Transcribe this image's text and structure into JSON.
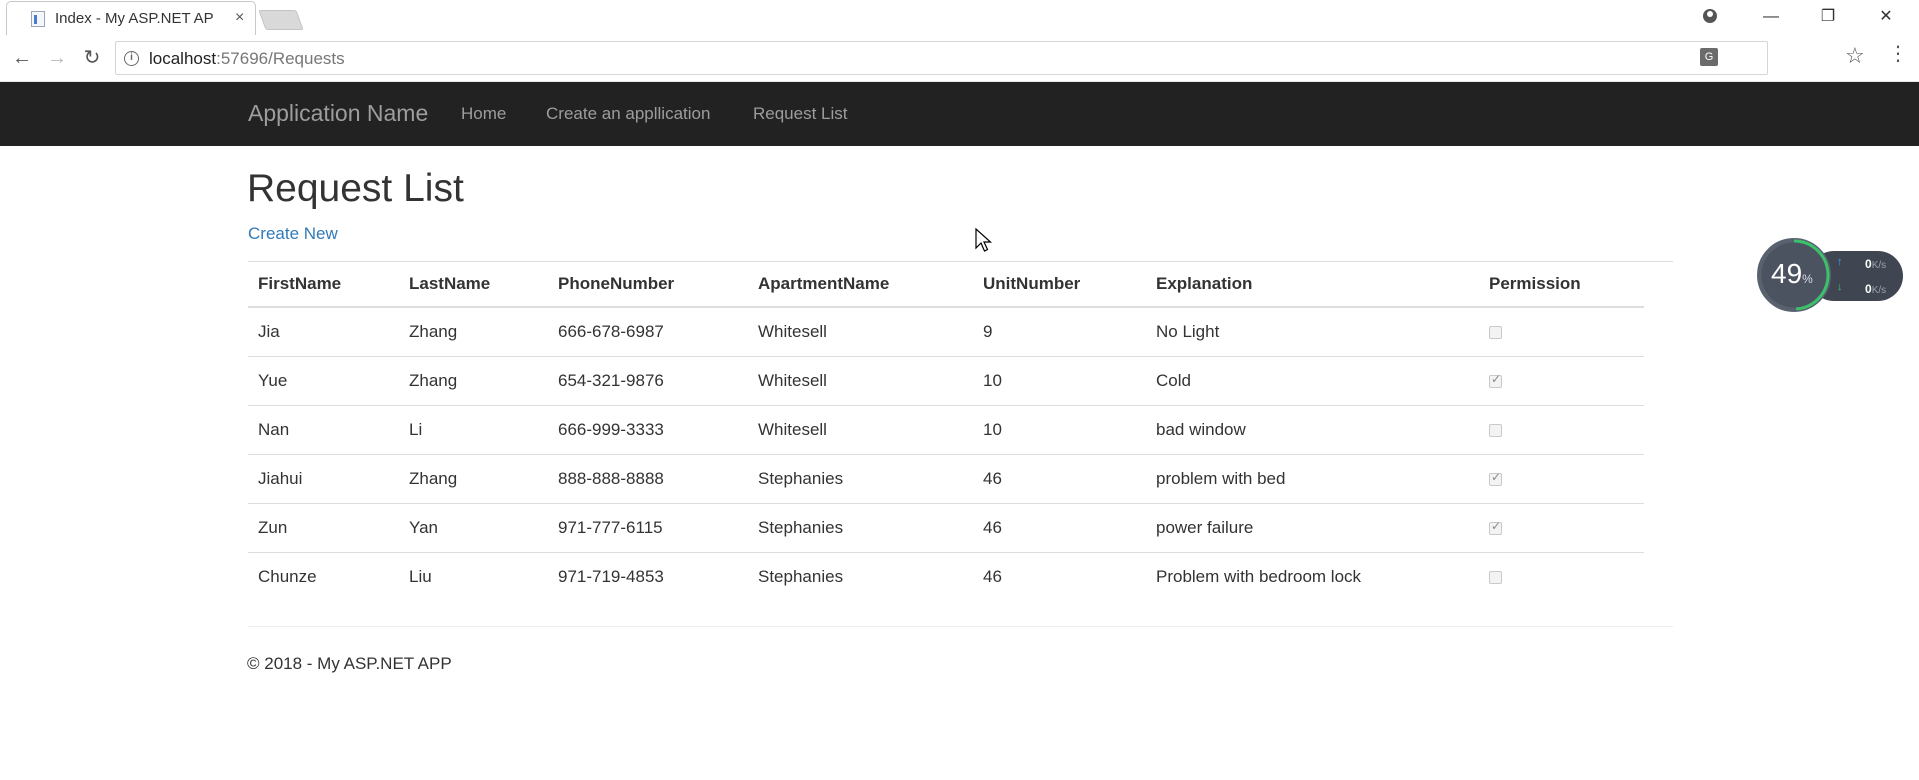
{
  "browser": {
    "tab_title": "Index - My ASP.NET AP",
    "tab_close": "×",
    "url_host": "localhost",
    "url_path": ":57696/Requests",
    "info_glyph": "i",
    "translate_glyph": "G",
    "win_min": "—",
    "win_max": "❐",
    "win_close": "✕",
    "back": "←",
    "forward": "→",
    "reload": "↻",
    "star": "☆",
    "menu": "⋮"
  },
  "navbar": {
    "brand": "Application Name",
    "links": [
      "Home",
      "Create an appllication",
      "Request List"
    ]
  },
  "page": {
    "title": "Request List",
    "create_link": "Create New"
  },
  "table": {
    "headers": [
      "FirstName",
      "LastName",
      "PhoneNumber",
      "ApartmentName",
      "UnitNumber",
      "Explanation",
      "Permission"
    ],
    "rows": [
      {
        "first": "Jia",
        "last": "Zhang",
        "phone": "666-678-6987",
        "apartment": "Whitesell",
        "unit": "9",
        "explanation": "No Light",
        "permission": false
      },
      {
        "first": "Yue",
        "last": "Zhang",
        "phone": "654-321-9876",
        "apartment": "Whitesell",
        "unit": "10",
        "explanation": "Cold",
        "permission": true
      },
      {
        "first": "Nan",
        "last": "Li",
        "phone": "666-999-3333",
        "apartment": "Whitesell",
        "unit": "10",
        "explanation": "bad window",
        "permission": false
      },
      {
        "first": "Jiahui",
        "last": "Zhang",
        "phone": "888-888-8888",
        "apartment": "Stephanies",
        "unit": "46",
        "explanation": "problem with bed",
        "permission": true
      },
      {
        "first": "Zun",
        "last": "Yan",
        "phone": "971-777-6115",
        "apartment": "Stephanies",
        "unit": "46",
        "explanation": "power failure",
        "permission": true
      },
      {
        "first": "Chunze",
        "last": "Liu",
        "phone": "971-719-4853",
        "apartment": "Stephanies",
        "unit": "46",
        "explanation": "Problem with bedroom lock",
        "permission": false
      }
    ]
  },
  "footer": {
    "text": "© 2018 - My ASP.NET APP"
  },
  "speed_widget": {
    "percent": "49",
    "percent_sign": "%",
    "up_value": "0",
    "down_value": "0",
    "unit": "K/s",
    "up_arrow": "↑",
    "down_arrow": "↓"
  },
  "colors": {
    "navbar_bg": "#222222",
    "navbar_text": "#9d9d9d",
    "link": "#337ab7",
    "widget_ring": "#3bc16a"
  }
}
